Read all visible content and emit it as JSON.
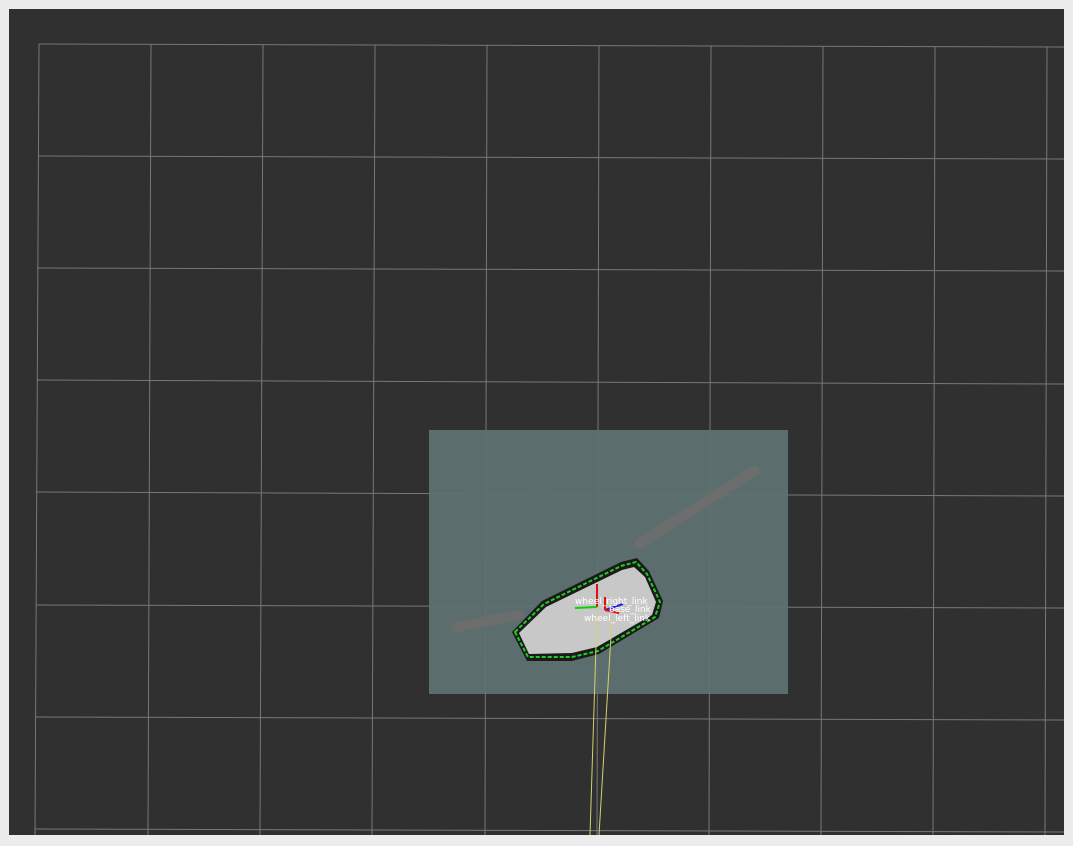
{
  "view": {
    "background_color": "#303030",
    "window_border_color": "#ececec",
    "grid_color": "#8a8a8a"
  },
  "map": {
    "costmap_color": "#5e7271",
    "free_space_color": "#c8c8c8",
    "obstacle_color": "#1a1a1a",
    "footprint_color": "#22cc22",
    "path_color": "#d4d46a"
  },
  "robot": {
    "frames": [
      {
        "label": "wheel_right_link"
      },
      {
        "label": "base_link"
      },
      {
        "label": "wheel_left_link"
      }
    ],
    "axis_colors": {
      "x": "#dd1111",
      "y": "#11cc11",
      "z": "#2222dd"
    }
  }
}
